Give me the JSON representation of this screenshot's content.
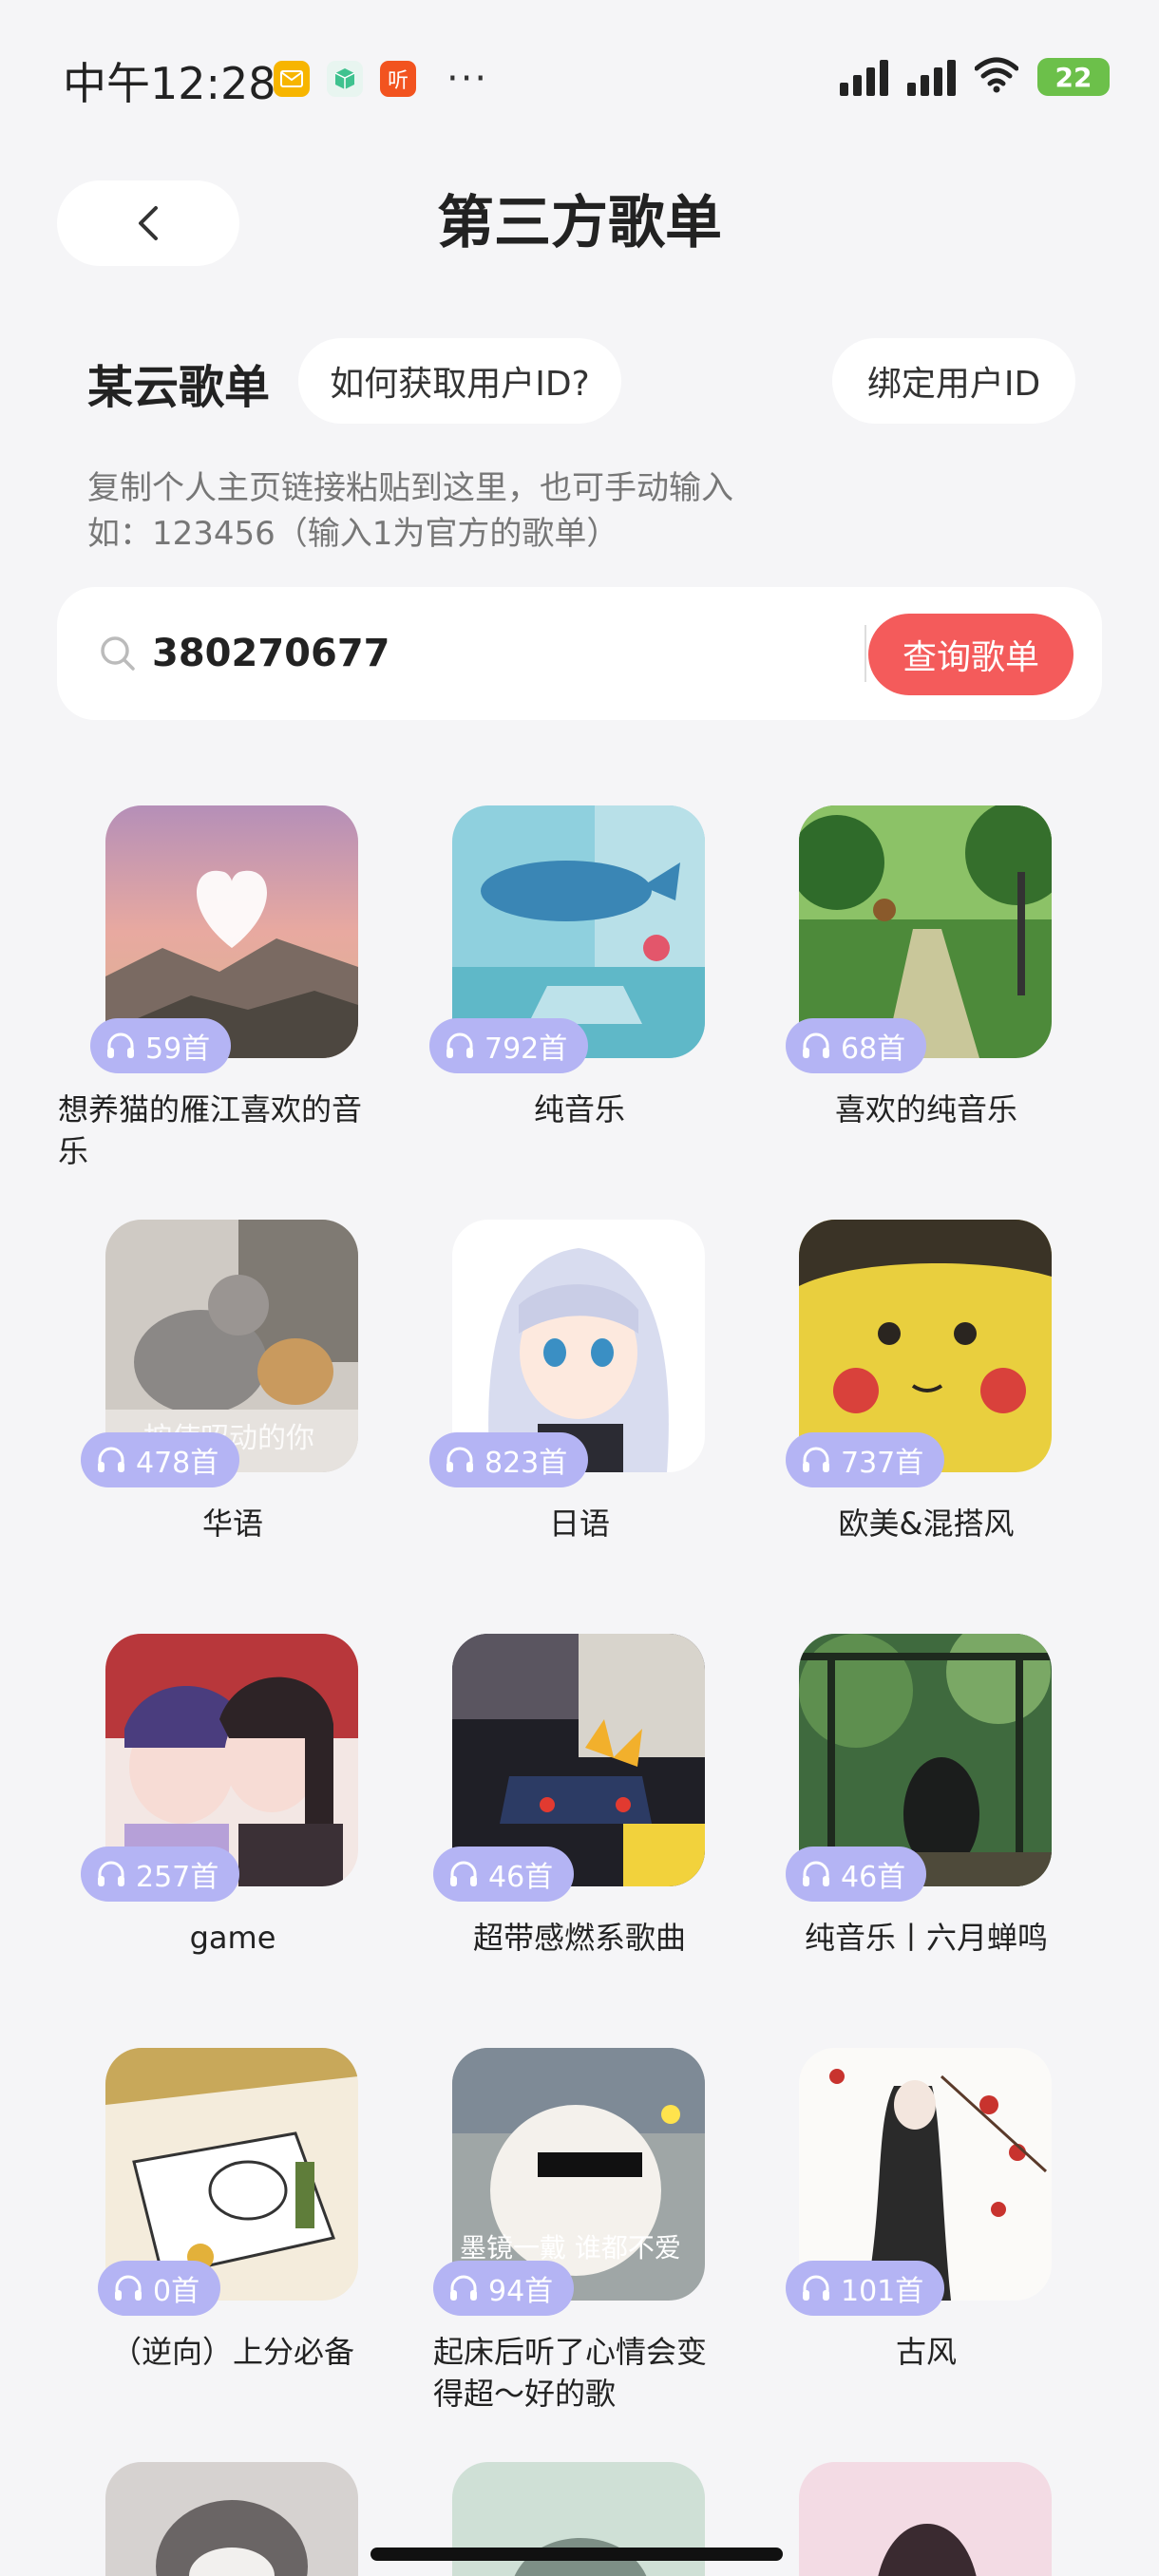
{
  "status_bar": {
    "time": "中午12:28",
    "notification_icons": [
      "mail-icon",
      "cube-icon",
      "ting-app-icon"
    ],
    "ting_label": "听",
    "more": "···",
    "battery": "22"
  },
  "header": {
    "title": "第三方歌单"
  },
  "section": {
    "title": "某云歌单",
    "how_to_label": "如何获取用户ID?",
    "bind_label": "绑定用户ID",
    "hint_line1": "复制个人主页链接粘贴到这里，也可手动输入",
    "hint_line2": "如：123456（输入1为官方的歌单）"
  },
  "search": {
    "value": "380270677",
    "button_label": "查询歌单"
  },
  "playlists": [
    {
      "title": "想养猫的雁江喜欢的音乐",
      "count": "59首"
    },
    {
      "title": "纯音乐",
      "count": "792首"
    },
    {
      "title": "喜欢的纯音乐",
      "count": "68首"
    },
    {
      "title": "华语",
      "count": "478首"
    },
    {
      "title": "日语",
      "count": "823首"
    },
    {
      "title": "欧美&混搭风",
      "count": "737首"
    },
    {
      "title": "game",
      "count": "257首"
    },
    {
      "title": "超带感燃系歌曲",
      "count": "46首"
    },
    {
      "title": "纯音乐丨六月蝉鸣",
      "count": "46首"
    },
    {
      "title": "（逆向）上分必备",
      "count": "0首"
    },
    {
      "title": "起床后听了心情会变得超～好的歌",
      "count": "94首"
    },
    {
      "title": "古风",
      "count": "101首"
    }
  ],
  "cover_texts": {
    "card4": "按使昭动的你",
    "card11": "墨镜一戴 谁都不爱"
  }
}
